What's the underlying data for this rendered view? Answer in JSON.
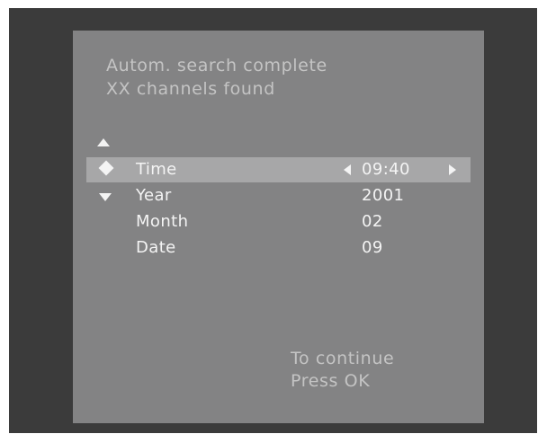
{
  "header": {
    "line1": "Autom. search complete",
    "line2": "XX channels found"
  },
  "menu": {
    "items": [
      {
        "label": "Time",
        "value": "09:40",
        "selected": true
      },
      {
        "label": "Year",
        "value": "2001"
      },
      {
        "label": "Month",
        "value": "02"
      },
      {
        "label": "Date",
        "value": "09"
      }
    ]
  },
  "footer": {
    "line1": "To continue",
    "line2": "Press OK"
  },
  "icons": {
    "scroll_up": "triangle-up-icon",
    "navigate": "diamond-navigate-icon",
    "scroll_down": "triangle-down-icon",
    "decrease": "triangle-left-icon",
    "increase": "triangle-right-icon"
  },
  "colors": {
    "screen_border": "#3b3b3b",
    "panel_background": "#838384",
    "selection_highlight": "#a7a7a8",
    "header_text": "#c4c4c4",
    "item_text": "#f4f4f4"
  }
}
